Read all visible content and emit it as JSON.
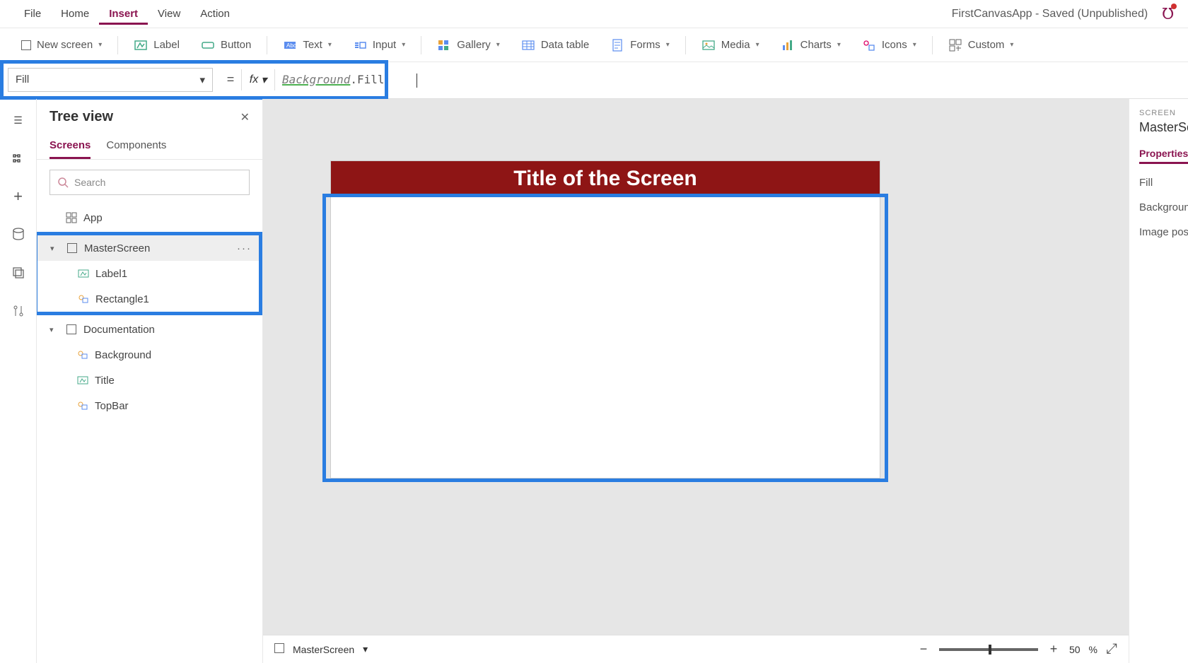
{
  "menubar": {
    "items": [
      "File",
      "Home",
      "Insert",
      "View",
      "Action"
    ],
    "active_index": 2,
    "app_title": "FirstCanvasApp - Saved (Unpublished)"
  },
  "ribbon": {
    "new_screen": "New screen",
    "label": "Label",
    "button": "Button",
    "text": "Text",
    "input": "Input",
    "gallery": "Gallery",
    "data_table": "Data table",
    "forms": "Forms",
    "media": "Media",
    "charts": "Charts",
    "icons": "Icons",
    "custom": "Custom"
  },
  "formula": {
    "property": "Fill",
    "token1": "Background",
    "dot": ".",
    "token2": "Fill"
  },
  "treeview": {
    "title": "Tree view",
    "tabs": [
      "Screens",
      "Components"
    ],
    "active_tab": 0,
    "search_placeholder": "Search",
    "nodes": {
      "app": "App",
      "master": "MasterScreen",
      "label1": "Label1",
      "rect1": "Rectangle1",
      "doc": "Documentation",
      "bg": "Background",
      "title": "Title",
      "topbar": "TopBar"
    }
  },
  "canvas": {
    "screen_title": "Title of the Screen"
  },
  "statusbar": {
    "screen_name": "MasterScreen",
    "zoom_value": "50",
    "zoom_unit": "%"
  },
  "properties": {
    "section_label": "SCREEN",
    "object_name": "MasterScre",
    "tab": "Properties",
    "rows": [
      "Fill",
      "Background",
      "Image posit"
    ]
  }
}
